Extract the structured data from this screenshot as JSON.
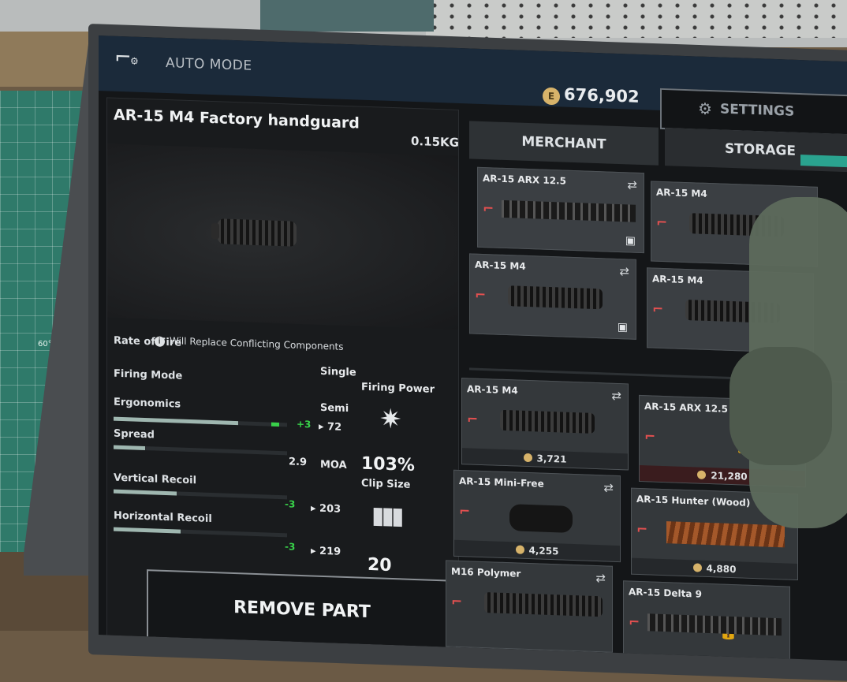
{
  "header": {
    "mode": "AUTO MODE",
    "balance": "676,902",
    "settings_label": "SETTINGS"
  },
  "item": {
    "name": "AR-15 M4 Factory handguard",
    "weight": "0.15KG",
    "notice": "Will Replace Conflicting Components"
  },
  "stats": {
    "rate_of_fire": "Rate of Fire",
    "firing_mode": "Firing Mode",
    "firing_mode_single": "Single",
    "firing_mode_semi": "Semi",
    "ergonomics": "Ergonomics",
    "ergonomics_delta": "+3",
    "ergonomics_value": "▸ 72",
    "ergonomics_level": 0.72,
    "spread": "Spread",
    "spread_value": "2.9",
    "spread_unit": "MOA",
    "vertical_recoil": "Vertical Recoil",
    "vertical_delta": "-3",
    "vertical_value": "▸ 203",
    "horizontal_recoil": "Horizontal Recoil",
    "horizontal_delta": "-3",
    "horizontal_value": "▸ 219",
    "firing_power_label": "Firing Power",
    "firing_power_value": "103%",
    "clip_size_label": "Clip Size",
    "clip_size_value": "20"
  },
  "remove_label": "REMOVE PART",
  "tabs": {
    "merchant": "MERCHANT",
    "storage": "STORAGE"
  },
  "owned_parts": [
    {
      "name": "AR-15 ARX 12.5"
    },
    {
      "name": "AR-15 M4"
    },
    {
      "name": "AR-15 M4"
    },
    {
      "name": "AR-15 M4"
    }
  ],
  "merchant_parts": [
    {
      "name": "AR-15 M4",
      "price": "3,721"
    },
    {
      "name": "AR-15 ARX 12.5",
      "price": "21,280"
    },
    {
      "name": "AR-15 Mini-Free",
      "price": "4,255"
    },
    {
      "name": "AR-15 Hunter (Wood)",
      "price": "4,880"
    },
    {
      "name": "M16 Polymer",
      "price": ""
    },
    {
      "name": "AR-15 Delta 9",
      "price": ""
    }
  ],
  "icons": {
    "swap": "swap-icon",
    "crate": "crate-icon",
    "coin": "coin-icon",
    "lock": "lock-icon"
  },
  "colors": {
    "header_bg": "#1b2a3a",
    "positive": "#38d34a",
    "coin": "#d7b36a",
    "gun_icon": "#e35050"
  },
  "env": {
    "mat_label": "60°"
  }
}
